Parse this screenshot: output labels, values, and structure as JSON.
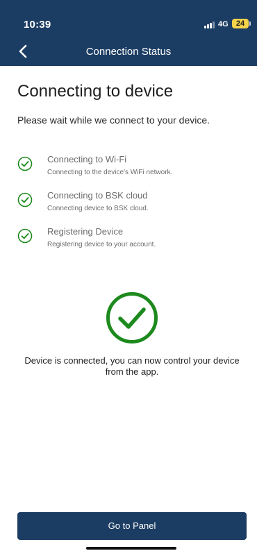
{
  "status_bar": {
    "time": "10:39",
    "network": "4G",
    "battery": "24"
  },
  "nav": {
    "title": "Connection Status",
    "back_icon": "chevron-left-icon"
  },
  "heading": "Connecting to device",
  "subtitle": "Please wait while we connect to your device.",
  "steps": [
    {
      "title": "Connecting to Wi-Fi",
      "desc": "Connecting to the device's WiFi network.",
      "icon": "check-circle-icon"
    },
    {
      "title": "Connecting to BSK cloud",
      "desc": "Connecting device to BSK cloud.",
      "icon": "check-circle-icon"
    },
    {
      "title": "Registering Device",
      "desc": "Registering device to your account.",
      "icon": "check-circle-icon"
    }
  ],
  "result": {
    "icon": "check-circle-icon",
    "message": "Device is connected, you can now control your device from the app."
  },
  "primary_button": {
    "label": "Go to Panel"
  },
  "colors": {
    "header": "#1c3d63",
    "success": "#1d8a1d",
    "battery": "#f4d24a",
    "button": "#1c3d63"
  }
}
